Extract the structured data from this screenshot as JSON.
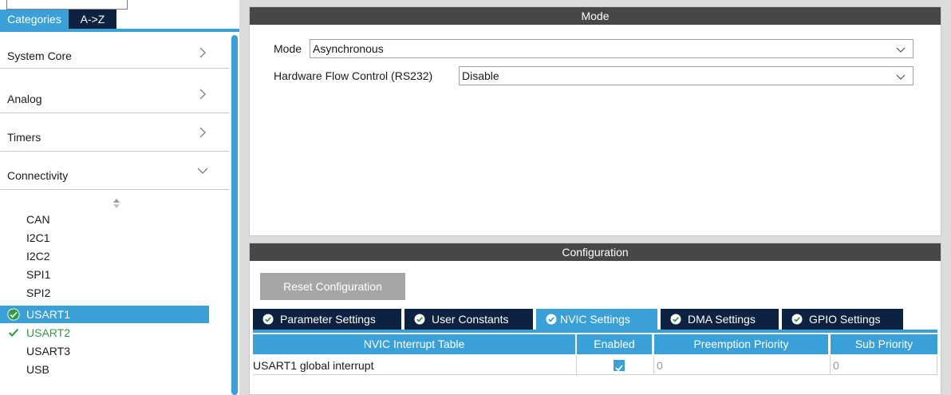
{
  "left": {
    "tabs": [
      {
        "label": "Categories"
      },
      {
        "label": "A->Z"
      }
    ],
    "categories": [
      {
        "label": "System Core",
        "expanded": false
      },
      {
        "label": "Analog",
        "expanded": false
      },
      {
        "label": "Timers",
        "expanded": false
      },
      {
        "label": "Connectivity",
        "expanded": true
      }
    ],
    "connectivity_items": [
      {
        "label": "CAN",
        "state": "none"
      },
      {
        "label": "I2C1",
        "state": "none"
      },
      {
        "label": "I2C2",
        "state": "none"
      },
      {
        "label": "SPI1",
        "state": "none"
      },
      {
        "label": "SPI2",
        "state": "none"
      },
      {
        "label": "USART1",
        "state": "selected"
      },
      {
        "label": "USART2",
        "state": "enabled"
      },
      {
        "label": "USART3",
        "state": "none"
      },
      {
        "label": "USB",
        "state": "none"
      }
    ]
  },
  "mode_panel": {
    "title": "Mode",
    "fields": [
      {
        "label": "Mode",
        "value": "Asynchronous"
      },
      {
        "label": "Hardware Flow Control (RS232)",
        "value": "Disable"
      }
    ]
  },
  "config_panel": {
    "title": "Configuration",
    "reset_label": "Reset Configuration",
    "tabs": [
      {
        "label": "Parameter Settings",
        "active": false
      },
      {
        "label": "User Constants",
        "active": false
      },
      {
        "label": "NVIC Settings",
        "active": true
      },
      {
        "label": "DMA Settings",
        "active": false
      },
      {
        "label": "GPIO Settings",
        "active": false
      }
    ],
    "table": {
      "headers": [
        "NVIC Interrupt Table",
        "Enabled",
        "Preemption Priority",
        "Sub Priority"
      ],
      "rows": [
        {
          "name": "USART1 global interrupt",
          "enabled": true,
          "preemption": "0",
          "sub": "0"
        }
      ]
    }
  },
  "colors": {
    "accent": "#39a0d8",
    "dark_navy": "#0d2240",
    "panel_header": "#474747",
    "enabled_green": "#2e9b45"
  },
  "icons": [
    "chevron-right-icon",
    "chevron-down-icon",
    "sort-arrows-icon",
    "check-circle-icon",
    "checkmark-icon",
    "dropdown-arrow-icon",
    "checkbox-checked-icon"
  ]
}
